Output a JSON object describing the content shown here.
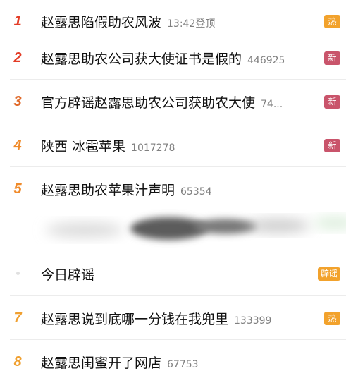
{
  "colors": {
    "rank_top": "#e33c26",
    "rank_mid": "#f08b2b",
    "badge_hot": "#f2a22c",
    "badge_new": "#c9546b",
    "badge_rumor": "#f2a22c"
  },
  "hot_list": [
    {
      "rank": "1",
      "title": "赵露思陷假助农风波",
      "count": "13:42登顶",
      "badge": "热"
    },
    {
      "rank": "2",
      "title": "赵露思助农公司获大使证书是假的",
      "count": "446925",
      "badge": "新"
    },
    {
      "rank": "3",
      "title": "官方辟谣赵露思助农公司获助农大使",
      "count": "74...",
      "badge": "新"
    },
    {
      "rank": "4",
      "title": "陕西 冰雹苹果",
      "count": "1017278",
      "badge": "新"
    },
    {
      "rank": "5",
      "title": "赵露思助农苹果汁声明",
      "count": "65354",
      "badge": ""
    },
    {
      "rank": "",
      "title": "今日辟谣",
      "count": "",
      "badge": "辟谣"
    },
    {
      "rank": "7",
      "title": "赵露思说到底哪一分钱在我兜里",
      "count": "133399",
      "badge": "热"
    },
    {
      "rank": "8",
      "title": "赵露思闺蜜开了网店",
      "count": "67753",
      "badge": ""
    }
  ]
}
